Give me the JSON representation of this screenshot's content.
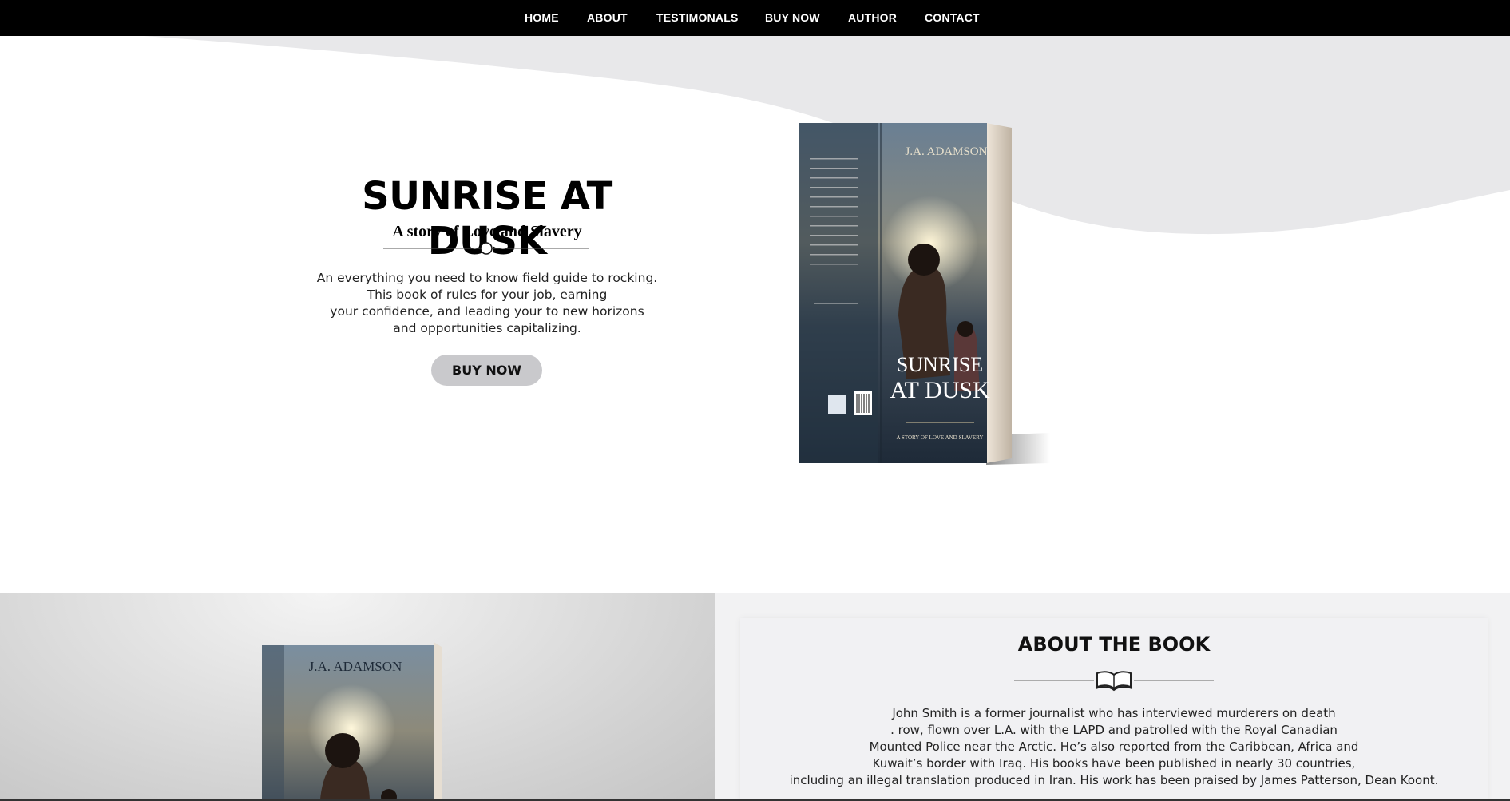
{
  "nav": {
    "items": [
      {
        "label": "HOME"
      },
      {
        "label": "ABOUT"
      },
      {
        "label": "TESTIMONALS"
      },
      {
        "label": "BUY NOW"
      },
      {
        "label": "AUTHOR"
      },
      {
        "label": "CONTACT"
      }
    ]
  },
  "hero": {
    "title": "SUNRISE AT DUSK",
    "subtitle": "A story of Love and Slavery",
    "description_lines": [
      "An everything you need to know field guide to rocking.",
      "This book of rules for your job, earning",
      "your confidence, and leading your to new horizons",
      "and opportunities capitalizing."
    ],
    "buy_button": "BUY NOW"
  },
  "book_cover": {
    "author": "J.A. ADAMSON",
    "title_line1": "SUNRISE",
    "title_line2": "AT DUSK",
    "tagline": "A STORY OF LOVE AND SLAVERY"
  },
  "about": {
    "title": "ABOUT THE BOOK",
    "text_lines": [
      "John Smith is a former journalist who has interviewed murderers on death",
      ". row, flown over L.A. with the LAPD and patrolled with the Royal Canadian",
      "Mounted Police near the Arctic. He’s also reported from the Caribbean, Africa and",
      "Kuwait’s border with Iraq. His books have been published in nearly 30 countries,",
      "including an illegal translation produced in Iran. His work has been praised by James Patterson, Dean Koont."
    ]
  },
  "colors": {
    "nav_bg": "#000000",
    "wave_gray": "#e8e8ea",
    "button_bg": "#c9c9cc",
    "about_bg": "#f1f1f3"
  }
}
